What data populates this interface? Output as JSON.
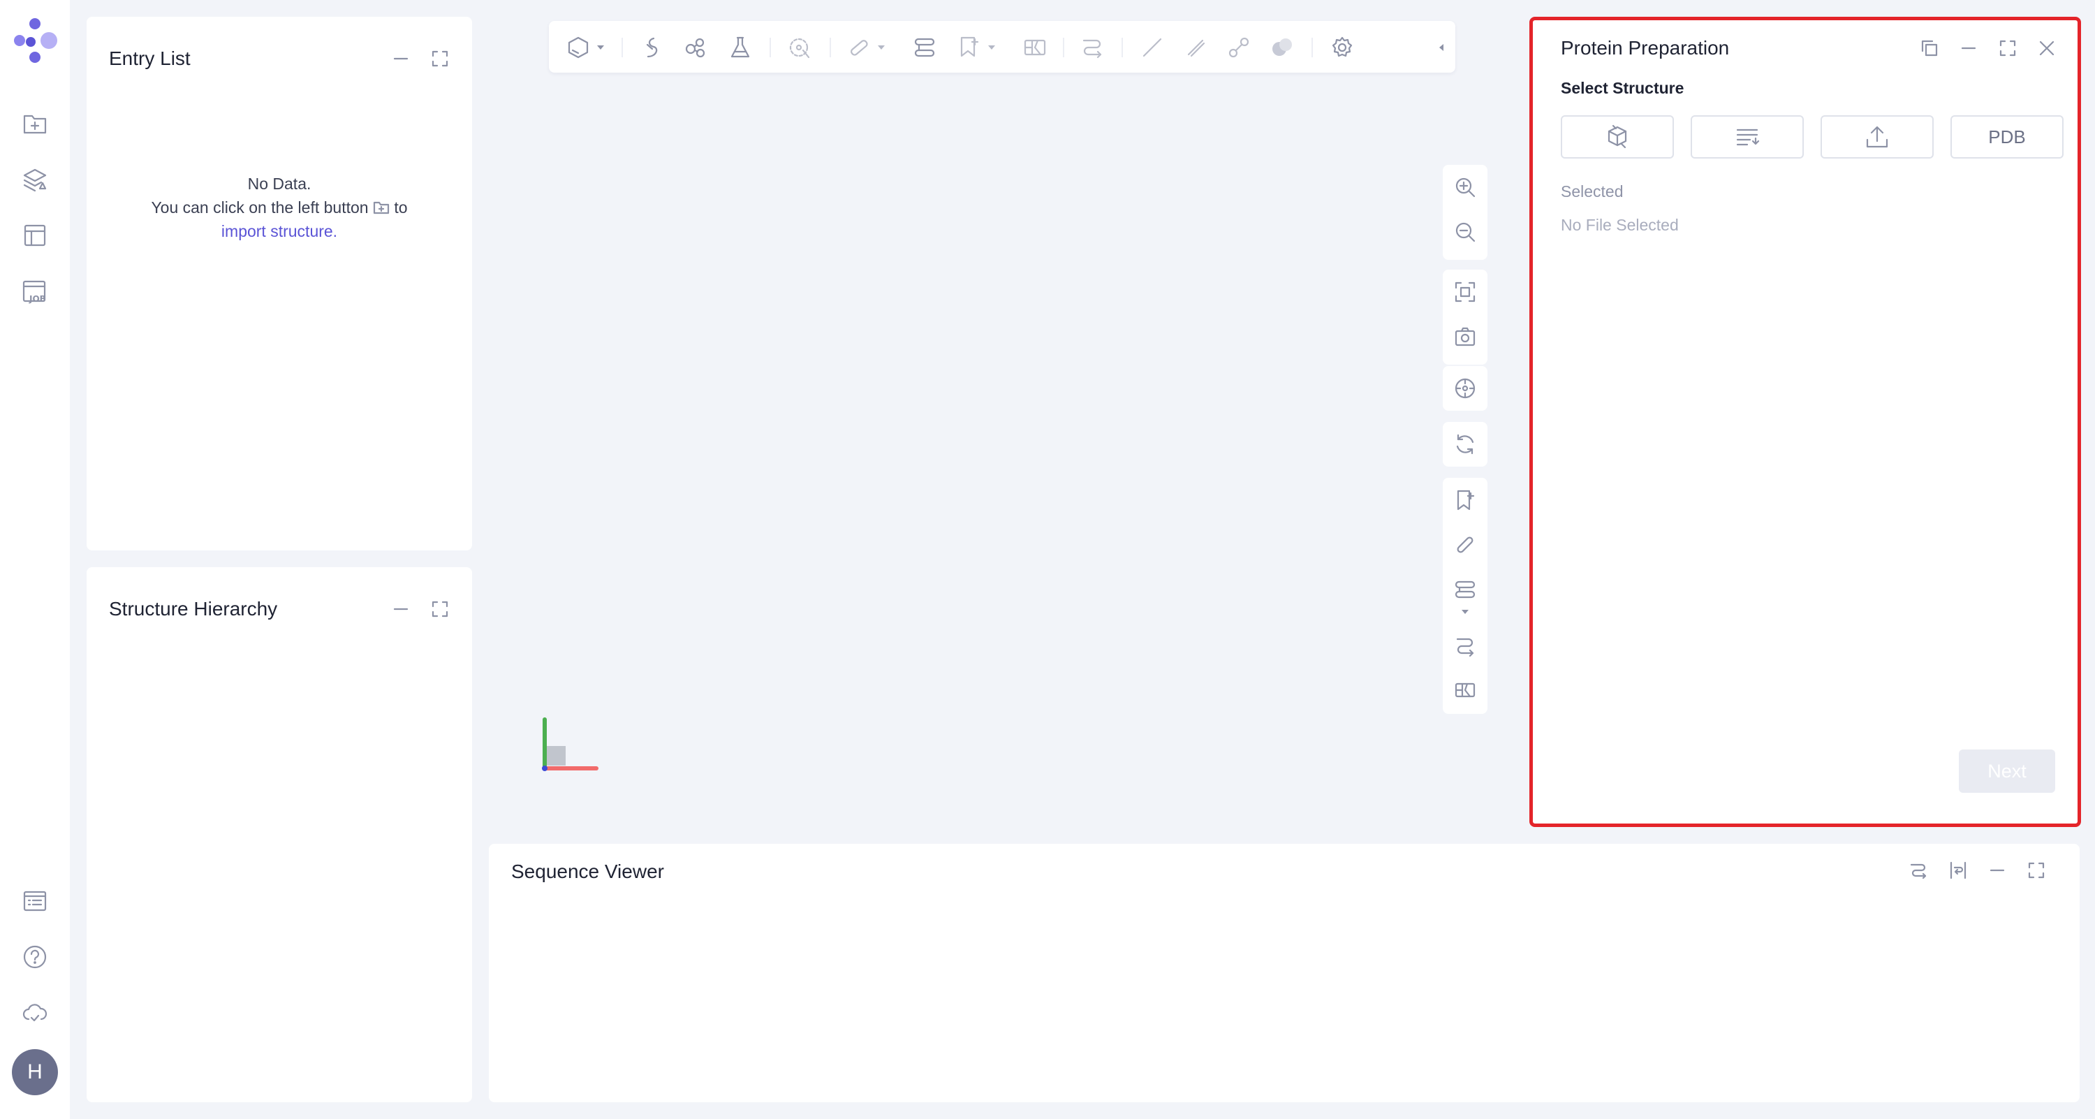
{
  "panels": {
    "entry_list": {
      "title": "Entry List",
      "empty_line1": "No Data.",
      "empty_line2a": "You can click on the left button",
      "empty_line2b": "to",
      "empty_link": "import structure."
    },
    "structure_hierarchy": {
      "title": "Structure Hierarchy"
    },
    "sequence_viewer": {
      "title": "Sequence Viewer"
    },
    "protein_preparation": {
      "title": "Protein Preparation",
      "section": "Select Structure",
      "pdb_label": "PDB",
      "selected_label": "Selected",
      "no_file": "No File Selected",
      "next_label": "Next"
    }
  },
  "user": {
    "initial": "H"
  },
  "colors": {
    "accent": "#5b54d6",
    "highlight_border": "#e4242a",
    "axis_x": "#f26b6b",
    "axis_y": "#4caf50"
  }
}
